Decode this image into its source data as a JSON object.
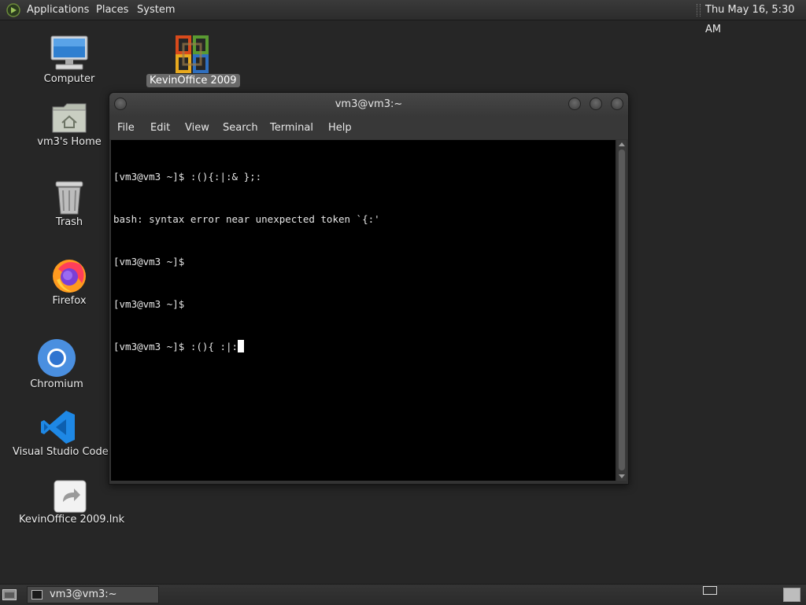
{
  "top_panel": {
    "menus": {
      "applications": "Applications",
      "places": "Places",
      "system": "System"
    },
    "clock": "Thu May 16,  5:30 AM"
  },
  "desktop": {
    "icons": {
      "computer": "Computer",
      "home": "vm3's Home",
      "trash": "Trash",
      "firefox": "Firefox",
      "chromium": "Chromium",
      "vscode": "Visual Studio Code",
      "kevinoffice_lnk": "KevinOffice 2009.lnk",
      "kevinoffice": "KevinOffice 2009"
    },
    "selected_icon": "KevinOffice 2009"
  },
  "terminal": {
    "title": "vm3@vm3:~",
    "menu": {
      "file": "File",
      "edit": "Edit",
      "view": "View",
      "search": "Search",
      "terminal": "Terminal",
      "help": "Help"
    },
    "lines": {
      "l1": "[vm3@vm3 ~]$ :(){:|:& };:",
      "l2": "bash: syntax error near unexpected token `{:'",
      "l3": "[vm3@vm3 ~]$",
      "l4": "[vm3@vm3 ~]$",
      "l5": "[vm3@vm3 ~]$ :(){ :|:"
    }
  },
  "taskbar": {
    "tasks": {
      "terminal": "vm3@vm3:~"
    }
  },
  "colors": {
    "desktop_bg": "#262626",
    "panel_bg": "#2f2f2f",
    "terminal_bg": "#000000",
    "terminal_fg": "#e6e6e6",
    "selection_bg": "#6a6a6a"
  }
}
